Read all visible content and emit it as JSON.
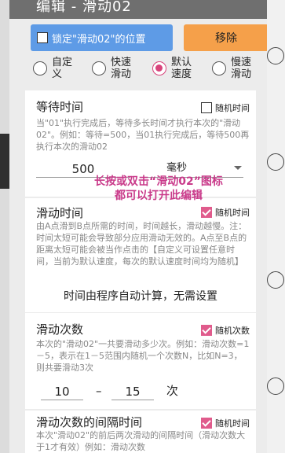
{
  "dialog": {
    "title": "编辑 - 滑动02",
    "lock_button": "锁定\"滑动02\"的位置",
    "remove_button": "移除"
  },
  "speed_options": [
    {
      "label_line1": "自定",
      "label_line2": "义",
      "selected": false
    },
    {
      "label_line1": "快速",
      "label_line2": "滑动",
      "selected": false
    },
    {
      "label_line1": "默认",
      "label_line2": "速度",
      "selected": true
    },
    {
      "label_line1": "慢速",
      "label_line2": "滑动",
      "selected": false
    }
  ],
  "wait_card": {
    "title": "等待时间",
    "random_label": "随机时间",
    "random_checked": false,
    "desc": "当\"01\"执行完成后，等待多长时间才执行本次的\"滑动02\"。例如：等待=500，当01执行完成后，等待500再执行本次的滑动02",
    "value": "500",
    "unit": "毫秒"
  },
  "overlay": {
    "line1": "长按或双击“滑动02”图标",
    "line2": "都可以打开此编辑"
  },
  "slide_time_card": {
    "title": "滑动时间",
    "random_label": "随机时间",
    "random_checked": true,
    "desc": "由A点滑到B点所需的时间，时间越长，滑动越慢。注：时间太短可能会导致部分应用滑动无效的。A点至B点的距离太短可能会被当作点击的【自定义可设置任意时间，当前为默认速度，每次的默认速度时间均为随机】",
    "auto_text": "时间由程序自动计算，无需设置"
  },
  "slide_count_card": {
    "title": "滑动次数",
    "random_label": "随机次数",
    "random_checked": true,
    "desc": "本次的\"滑动02\"一共要滑动多少次。例如：滑动次数=1－5，表示在1－5范围内随机一个次数N，比如N=3，则共要滑动3次",
    "min": "10",
    "dash": "–",
    "max": "15",
    "unit": "次"
  },
  "interval_card": {
    "title": "滑动次数的间隔时间",
    "random_label": "随机时间",
    "random_checked": true,
    "desc": "本次\"滑动02\"的前后两次滑动的间隔时间（滑动次数大于1才有效）例如：滑动次数"
  }
}
